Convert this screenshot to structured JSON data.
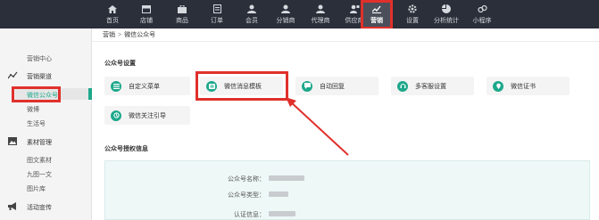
{
  "topnav": {
    "items": [
      {
        "label": "首页",
        "icon": "home-icon"
      },
      {
        "label": "店铺",
        "icon": "shop-icon"
      },
      {
        "label": "商品",
        "icon": "goods-icon"
      },
      {
        "label": "订单",
        "icon": "order-icon"
      },
      {
        "label": "会员",
        "icon": "member-icon"
      },
      {
        "label": "分销商",
        "icon": "distributor-icon"
      },
      {
        "label": "代理商",
        "icon": "agent-icon"
      },
      {
        "label": "供应商",
        "icon": "supplier-icon"
      },
      {
        "label": "营销",
        "icon": "marketing-chart-icon",
        "active": true
      },
      {
        "label": "设置",
        "icon": "gear-icon"
      },
      {
        "label": "分析统计",
        "icon": "pie-chart-icon"
      },
      {
        "label": "小程序",
        "icon": "mini-program-icon"
      }
    ]
  },
  "sidebar": {
    "marketing_center": "营销中心",
    "channel_group": "营销渠道",
    "channel_items": [
      "微信公众号",
      "微博",
      "生活号"
    ],
    "material_group": "素材管理",
    "material_items": [
      "图文素材",
      "九图一文",
      "图片库"
    ],
    "activity_group": "活动宣传"
  },
  "breadcrumb": {
    "parent": "营销",
    "separator": ">",
    "current": "微信公众号"
  },
  "settings": {
    "title": "公众号设置",
    "cards": [
      {
        "label": "自定义菜单",
        "icon": "list-icon"
      },
      {
        "label": "微信消息模板",
        "icon": "message-template-icon",
        "highlighted": true
      },
      {
        "label": "自动回复",
        "icon": "chat-bubble-icon"
      },
      {
        "label": "多客服设置",
        "icon": "customer-service-icon"
      },
      {
        "label": "微信证书",
        "icon": "certificate-icon"
      },
      {
        "label": "微信关注引导",
        "icon": "follow-guide-icon"
      }
    ]
  },
  "auth": {
    "title": "公众号授权信息",
    "fields": [
      {
        "label": "公众号名称："
      },
      {
        "label": "公众号类型："
      },
      {
        "label": "认证信息："
      }
    ]
  },
  "colors": {
    "accent": "#1ea88b",
    "highlight": "#e0302b",
    "nav_bg": "#2b2f3a"
  }
}
